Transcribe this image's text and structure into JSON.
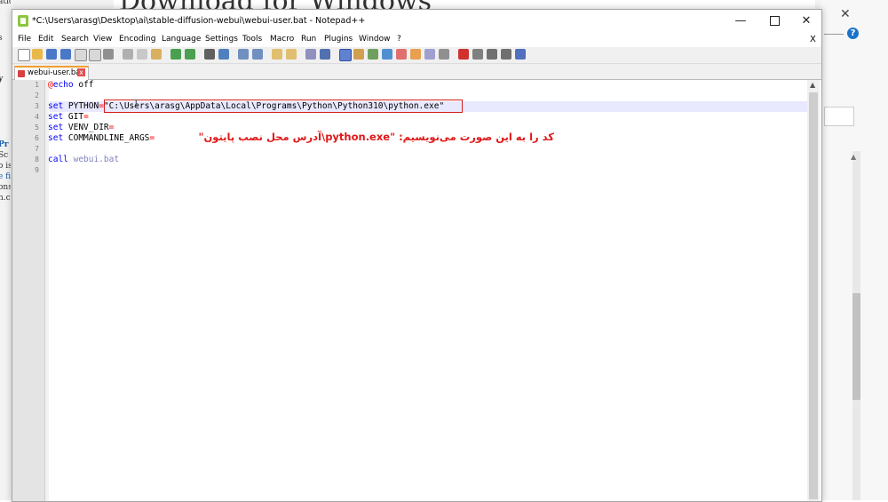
{
  "background": {
    "heading": "Download for Windows",
    "left_fragments": [
      "ation",
      "s",
      "y",
      "Pr",
      "Sc",
      "o is",
      "e fi",
      "ons",
      "n.c"
    ],
    "close_glyph": "✕",
    "help_glyph": "?"
  },
  "window": {
    "title": "*C:\\Users\\arasg\\Desktop\\ai\\stable-diffusion-webui\\webui-user.bat - Notepad++",
    "minimize_glyph": "—",
    "close_glyph": "✕"
  },
  "menu": [
    "File",
    "Edit",
    "Search",
    "View",
    "Encoding",
    "Language",
    "Settings",
    "Tools",
    "Macro",
    "Run",
    "Plugins",
    "Window",
    "?"
  ],
  "menu_close": "X",
  "tab": {
    "label": "webui-user.bat",
    "close_glyph": "x"
  },
  "line_numbers": [
    "1",
    "2",
    "3",
    "4",
    "5",
    "6",
    "7",
    "8",
    "9"
  ],
  "code": {
    "l1": {
      "at": "@",
      "cmd": "echo",
      "rest": " off"
    },
    "l3": {
      "kw": "set",
      "name": " PYTHON",
      "eq": "=",
      "value": "\"C:\\Users\\arasg\\AppData\\Local\\Programs\\Python\\Python310\\python.exe\""
    },
    "l4": {
      "kw": "set",
      "name": " GIT",
      "eq": "="
    },
    "l5": {
      "kw": "set",
      "name": " VENV_DIR",
      "eq": "="
    },
    "l6": {
      "kw": "set",
      "name": " COMMANDLINE_ARGS",
      "eq": "="
    },
    "l8": {
      "kw": "call",
      "rest": " webui.bat"
    }
  },
  "annotation": {
    "line1": "کد را به این صورت می‌نویسیم:   \"python.exe\\آدرس محل نصب پایتون\""
  },
  "colors": {
    "keyword": "#0000ff",
    "operator": "#ff0000",
    "string": "#808080",
    "annotation": "#e01818",
    "tab_accent": "#f0a030"
  }
}
